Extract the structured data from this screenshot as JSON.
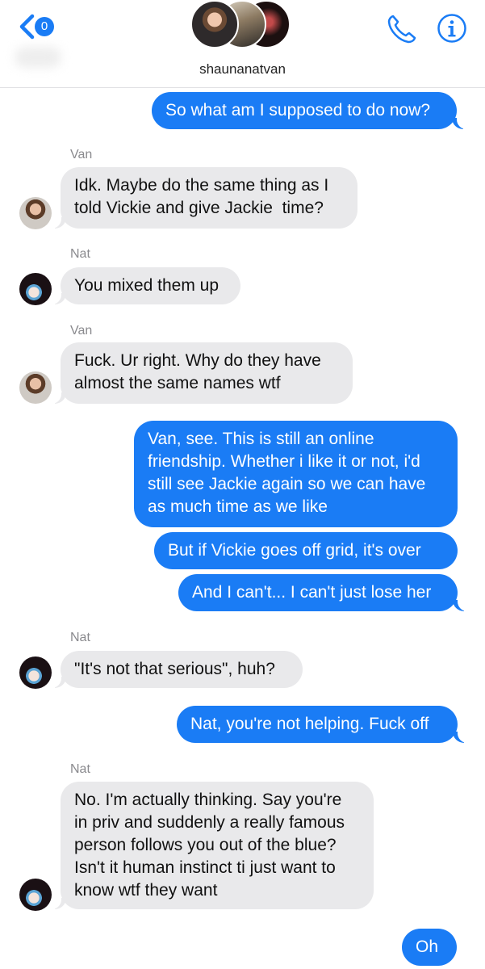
{
  "header": {
    "back_badge": "0",
    "group_name": "shaunanatvan"
  },
  "messages": [
    {
      "from": "me",
      "text": "So what am I supposed to do now?"
    },
    {
      "from": "Van",
      "sender_label": "Van",
      "text": "Idk. Maybe do the same thing as I\ntold Vickie and give Jackie  time?"
    },
    {
      "from": "Nat",
      "sender_label": "Nat",
      "text": "You mixed them up"
    },
    {
      "from": "Van",
      "sender_label": "Van",
      "text": "Fuck. Ur right. Why do they have\nalmost the same names wtf"
    },
    {
      "from": "me",
      "text": "Van, see. This is still an online\nfriendship. Whether i like it or not, i'd\nstill see Jackie again so we can have\nas much time as we like"
    },
    {
      "from": "me",
      "text": "But if Vickie goes off grid, it's over"
    },
    {
      "from": "me",
      "text": "And I can't... I can't just lose her"
    },
    {
      "from": "Nat",
      "sender_label": "Nat",
      "text": "\"It's not that serious\", huh?"
    },
    {
      "from": "me",
      "text": "Nat, you're not helping. Fuck off"
    },
    {
      "from": "Nat",
      "sender_label": "Nat",
      "text": "No. I'm actually thinking. Say you're\nin priv and suddenly a really famous\nperson follows you out of the blue?\nIsn't it human instinct ti just want to\nknow wtf they want"
    },
    {
      "from": "me",
      "text": "Oh"
    }
  ],
  "colors": {
    "accent": "#1a7cf5",
    "incoming_bubble": "#e9e9eb",
    "sender_label": "#8a8a8e"
  }
}
